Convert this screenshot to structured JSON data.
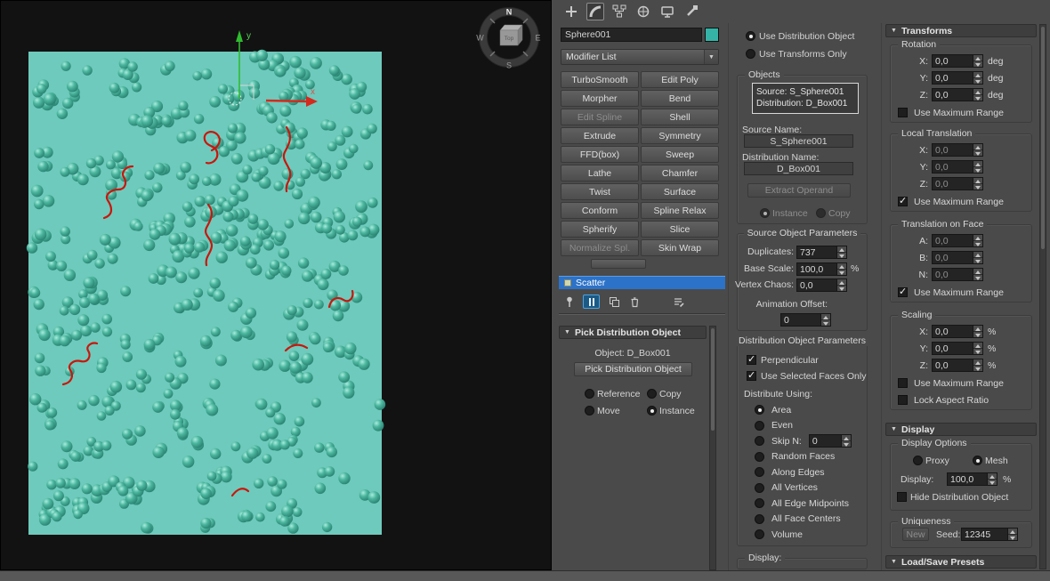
{
  "colors": {
    "object_teal": "#35b3a6",
    "plane_teal": "#6ecabc",
    "selection_blue": "#2c72c8",
    "spline_red": "#c8170c",
    "panel_gray": "#4a4a4a"
  },
  "viewport": {
    "compass": {
      "north": "N",
      "east": "E",
      "south": "S",
      "west": "W",
      "cube_face": "Top"
    },
    "axis_labels": {
      "y": "y",
      "x": "x"
    }
  },
  "command_panel": {
    "tabs": [
      {
        "name": "create",
        "selected": false
      },
      {
        "name": "modify",
        "selected": true
      },
      {
        "name": "hierarchy",
        "selected": false
      },
      {
        "name": "motion",
        "selected": false
      },
      {
        "name": "display",
        "selected": false
      },
      {
        "name": "utilities",
        "selected": false
      }
    ],
    "object_name": "Sphere001",
    "modifier_list_label": "Modifier List",
    "modifier_buttons": [
      {
        "label": "TurboSmooth",
        "enabled": true
      },
      {
        "label": "Edit Poly",
        "enabled": true
      },
      {
        "label": "Morpher",
        "enabled": true
      },
      {
        "label": "Bend",
        "enabled": true
      },
      {
        "label": "Edit Spline",
        "enabled": false
      },
      {
        "label": "Shell",
        "enabled": true
      },
      {
        "label": "Extrude",
        "enabled": true
      },
      {
        "label": "Symmetry",
        "enabled": true
      },
      {
        "label": "FFD(box)",
        "enabled": true
      },
      {
        "label": "Sweep",
        "enabled": true
      },
      {
        "label": "Lathe",
        "enabled": true
      },
      {
        "label": "Chamfer",
        "enabled": true
      },
      {
        "label": "Twist",
        "enabled": true
      },
      {
        "label": "Surface",
        "enabled": true
      },
      {
        "label": "Conform",
        "enabled": true
      },
      {
        "label": "Spline Relax",
        "enabled": true
      },
      {
        "label": "Spherify",
        "enabled": true
      },
      {
        "label": "Slice",
        "enabled": true
      },
      {
        "label": "Normalize Spl.",
        "enabled": false
      },
      {
        "label": "Skin Wrap",
        "enabled": true
      }
    ],
    "modifier_stack": {
      "selected_item": "Scatter"
    }
  },
  "pick_rollout": {
    "title": "Pick Distribution Object",
    "object_label": "Object: D_Box001",
    "pick_button": "Pick Distribution Object",
    "clone_options": [
      {
        "label": "Reference",
        "selected": false
      },
      {
        "label": "Copy",
        "selected": false
      },
      {
        "label": "Move",
        "selected": false
      },
      {
        "label": "Instance",
        "selected": true
      }
    ]
  },
  "scatter_objects": {
    "use_distribution_object": {
      "label": "Use Distribution Object",
      "selected": true
    },
    "use_transforms_only": {
      "label": "Use Transforms Only",
      "selected": false
    },
    "objects_group": "Objects",
    "operands": [
      "Source: S_Sphere001",
      "Distribution: D_Box001"
    ],
    "source_name_label": "Source Name:",
    "source_name": "S_Sphere001",
    "distribution_name_label": "Distribution Name:",
    "distribution_name": "D_Box001",
    "extract_operand_button": "Extract Operand",
    "instance_label": "Instance",
    "instance_selected": true,
    "copy_label": "Copy"
  },
  "source_object_parameters": {
    "title": "Source Object Parameters",
    "duplicates_label": "Duplicates:",
    "duplicates_value": "737",
    "base_scale_label": "Base Scale:",
    "base_scale_value": "100,0",
    "base_scale_unit": "%",
    "vertex_chaos_label": "Vertex Chaos:",
    "vertex_chaos_value": "0,0",
    "animation_offset_label": "Animation Offset:",
    "animation_offset_value": "0"
  },
  "distribution_object_parameters": {
    "title": "Distribution Object Parameters",
    "perpendicular": {
      "label": "Perpendicular",
      "checked": true
    },
    "use_selected_faces": {
      "label": "Use Selected Faces Only",
      "checked": true
    },
    "distribute_using_label": "Distribute Using:",
    "options": [
      {
        "label": "Area",
        "selected": true
      },
      {
        "label": "Even",
        "selected": false
      },
      {
        "label": "Skip N:",
        "selected": false,
        "value": "0"
      },
      {
        "label": "Random Faces",
        "selected": false
      },
      {
        "label": "Along Edges",
        "selected": false
      },
      {
        "label": "All Vertices",
        "selected": false
      },
      {
        "label": "All Edge Midpoints",
        "selected": false
      },
      {
        "label": "All Face Centers",
        "selected": false
      },
      {
        "label": "Volume",
        "selected": false
      }
    ],
    "display_group_label": "Display:"
  },
  "transforms": {
    "title": "Transforms",
    "use_maximum_range": "Use Maximum Range",
    "rotation": {
      "title": "Rotation",
      "unit": "deg",
      "disabled": false,
      "use_max_checked": false,
      "rows": [
        {
          "label": "X:",
          "value": "0,0"
        },
        {
          "label": "Y:",
          "value": "0,0"
        },
        {
          "label": "Z:",
          "value": "0,0"
        }
      ]
    },
    "local_translation": {
      "title": "Local Translation",
      "unit": "",
      "disabled": true,
      "use_max_checked": true,
      "rows": [
        {
          "label": "X:",
          "value": "0,0"
        },
        {
          "label": "Y:",
          "value": "0,0"
        },
        {
          "label": "Z:",
          "value": "0,0"
        }
      ]
    },
    "translation_on_face": {
      "title": "Translation on Face",
      "unit": "",
      "disabled": true,
      "use_max_checked": true,
      "rows": [
        {
          "label": "A:",
          "value": "0,0"
        },
        {
          "label": "B:",
          "value": "0,0"
        },
        {
          "label": "N:",
          "value": "0,0"
        }
      ]
    },
    "scaling": {
      "title": "Scaling",
      "unit": "%",
      "disabled": false,
      "use_max_checked": false,
      "lock_aspect_label": "Lock Aspect Ratio",
      "lock_aspect_checked": false,
      "rows": [
        {
          "label": "X:",
          "value": "0,0"
        },
        {
          "label": "Y:",
          "value": "0,0"
        },
        {
          "label": "Z:",
          "value": "0,0"
        }
      ]
    }
  },
  "display_rollout": {
    "title": "Display",
    "display_options_title": "Display Options",
    "proxy": {
      "label": "Proxy",
      "selected": false
    },
    "mesh": {
      "label": "Mesh",
      "selected": true
    },
    "display_label": "Display:",
    "display_value": "100,0",
    "display_unit": "%",
    "hide_distribution": {
      "label": "Hide Distribution Object",
      "checked": false
    },
    "uniqueness_title": "Uniqueness",
    "new_button": "New",
    "seed_label": "Seed:",
    "seed_value": "12345"
  },
  "presets_rollout": {
    "title": "Load/Save Presets"
  }
}
